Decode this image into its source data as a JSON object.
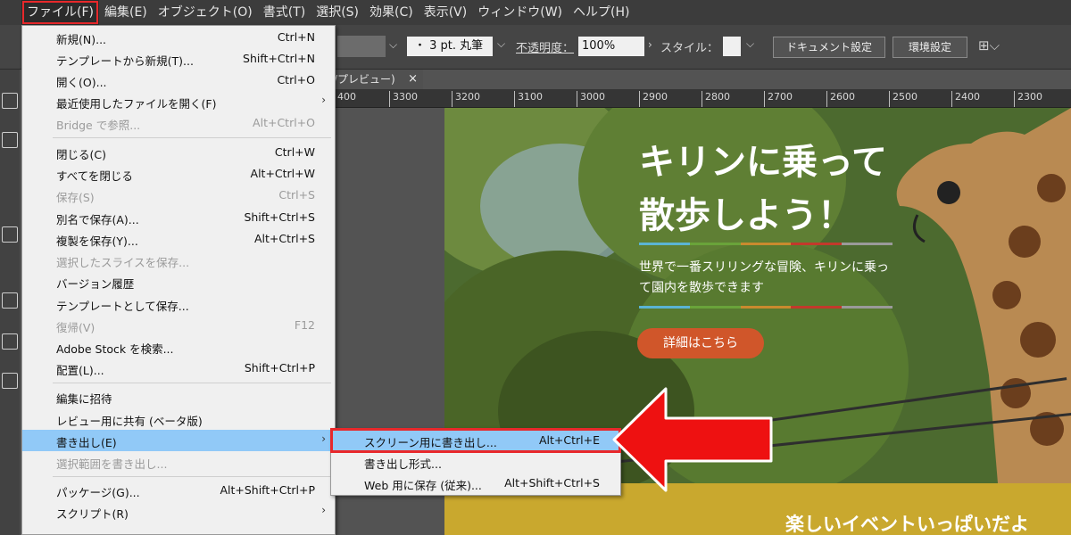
{
  "menubar": {
    "items": [
      "ファイル(F)",
      "編集(E)",
      "オブジェクト(O)",
      "書式(T)",
      "選択(S)",
      "効果(C)",
      "表示(V)",
      "ウィンドウ(W)",
      "ヘルプ(H)"
    ]
  },
  "control_bar": {
    "stroke_value": "・ 3 pt. 丸筆",
    "opacity_label": "不透明度：",
    "opacity_value": "100%",
    "style_label": "スタイル：",
    "document_settings_label": "ドキュメント設定",
    "preferences_label": "環境設定"
  },
  "document_tab": {
    "title": "/プレビュー)",
    "close": "×"
  },
  "ruler": {
    "ticks": [
      "400",
      "3300",
      "3200",
      "3100",
      "3000",
      "2900",
      "2800",
      "2700",
      "2600",
      "2500",
      "2400",
      "2300"
    ]
  },
  "artboard": {
    "title": "キリンに乗って\n散歩しよう！",
    "subtitle": "世界で一番スリリングな冒険、キリンに乗って園内を散歩できます",
    "button": "詳細はこちら",
    "band_text": "楽しいイベントいっぱいだよ",
    "stripe_colors": [
      "#5ab4d4",
      "#69a33a",
      "#c98a2e",
      "#c2392b",
      "#9a9a9a"
    ],
    "button_color": "#d0562a",
    "band_color": "#c9a82e"
  },
  "file_menu": {
    "items": [
      {
        "label": "新規(N)...",
        "shortcut": "Ctrl+N",
        "disabled": false,
        "submenu": false
      },
      {
        "label": "テンプレートから新規(T)...",
        "shortcut": "Shift+Ctrl+N",
        "disabled": false,
        "submenu": false
      },
      {
        "label": "開く(O)...",
        "shortcut": "Ctrl+O",
        "disabled": false,
        "submenu": false
      },
      {
        "label": "最近使用したファイルを開く(F)",
        "shortcut": "",
        "disabled": false,
        "submenu": true
      },
      {
        "label": "Bridge で参照...",
        "shortcut": "Alt+Ctrl+O",
        "disabled": true,
        "submenu": false
      },
      {
        "label": "閉じる(C)",
        "shortcut": "Ctrl+W",
        "disabled": false,
        "submenu": false
      },
      {
        "label": "すべてを閉じる",
        "shortcut": "Alt+Ctrl+W",
        "disabled": false,
        "submenu": false
      },
      {
        "label": "保存(S)",
        "shortcut": "Ctrl+S",
        "disabled": true,
        "submenu": false
      },
      {
        "label": "別名で保存(A)...",
        "shortcut": "Shift+Ctrl+S",
        "disabled": false,
        "submenu": false
      },
      {
        "label": "複製を保存(Y)...",
        "shortcut": "Alt+Ctrl+S",
        "disabled": false,
        "submenu": false
      },
      {
        "label": "選択したスライスを保存...",
        "shortcut": "",
        "disabled": true,
        "submenu": false
      },
      {
        "label": "バージョン履歴",
        "shortcut": "",
        "disabled": false,
        "submenu": false
      },
      {
        "label": "テンプレートとして保存...",
        "shortcut": "",
        "disabled": false,
        "submenu": false
      },
      {
        "label": "復帰(V)",
        "shortcut": "F12",
        "disabled": true,
        "submenu": false
      },
      {
        "label": "Adobe Stock を検索...",
        "shortcut": "",
        "disabled": false,
        "submenu": false
      },
      {
        "label": "配置(L)...",
        "shortcut": "Shift+Ctrl+P",
        "disabled": false,
        "submenu": false
      },
      {
        "label": "編集に招待",
        "shortcut": "",
        "disabled": false,
        "submenu": false
      },
      {
        "label": "レビュー用に共有 (ベータ版)",
        "shortcut": "",
        "disabled": false,
        "submenu": false
      },
      {
        "label": "書き出し(E)",
        "shortcut": "",
        "disabled": false,
        "submenu": true
      },
      {
        "label": "選択範囲を書き出し...",
        "shortcut": "",
        "disabled": true,
        "submenu": false
      },
      {
        "label": "パッケージ(G)...",
        "shortcut": "Alt+Shift+Ctrl+P",
        "disabled": false,
        "submenu": false
      },
      {
        "label": "スクリプト(R)",
        "shortcut": "",
        "disabled": false,
        "submenu": true
      }
    ],
    "highlighted_item": "書き出し(E)"
  },
  "export_submenu": {
    "items": [
      {
        "label": "スクリーン用に書き出し...",
        "shortcut": "Alt+Ctrl+E"
      },
      {
        "label": "書き出し形式...",
        "shortcut": ""
      },
      {
        "label": "Web 用に保存 (従来)...",
        "shortcut": "Alt+Shift+Ctrl+S"
      }
    ],
    "highlighted_item": "スクリーン用に書き出し..."
  },
  "annotation": {
    "highlight_color": "#e8282b",
    "arrow_color": "#ee1111"
  }
}
